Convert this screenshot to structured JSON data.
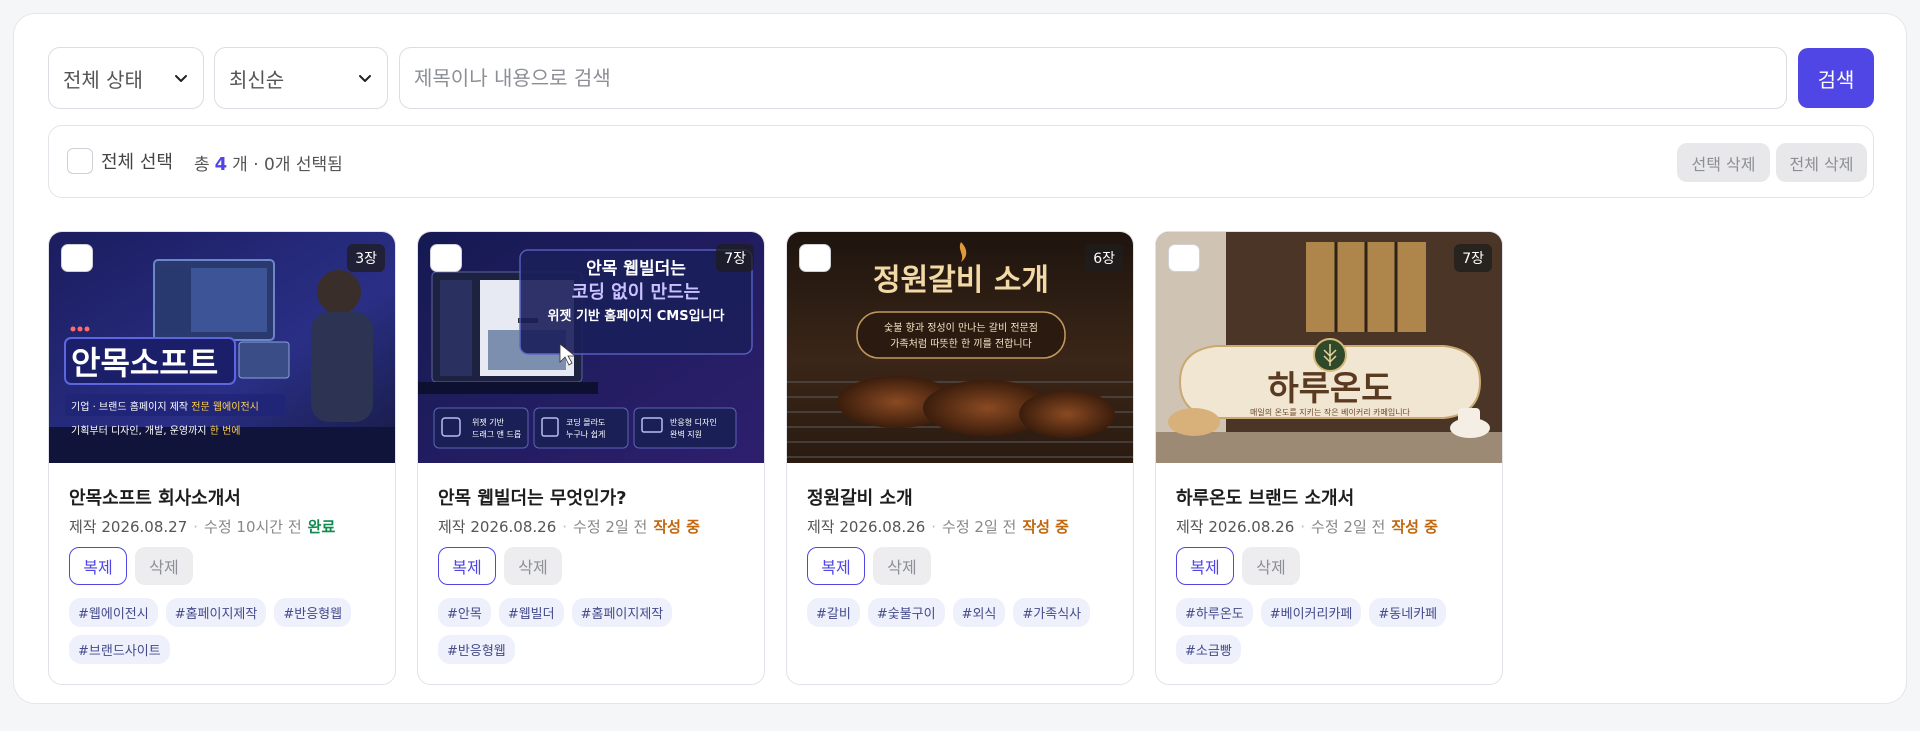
{
  "filters": {
    "status_label": "전체 상태",
    "sort_label": "최신순",
    "search_placeholder": "제목이나 내용으로 검색",
    "search_button": "검색"
  },
  "selection": {
    "select_all_label": "전체 선택",
    "total_prefix": "총",
    "total_count": "4",
    "total_suffix": "개 · 0개 선택됨",
    "delete_selected": "선택 삭제",
    "delete_all": "전체 삭제"
  },
  "cards": [
    {
      "title": "안목소프트 회사소개서",
      "pages": "3장",
      "created": "제작 2026.08.27",
      "modified": "수정 10시간 전",
      "status": "완료",
      "dup_label": "복제",
      "del_label": "삭제",
      "tags": [
        "#웹에이전시",
        "#홈페이지제작",
        "#반응형웹",
        "#브랜드사이트"
      ],
      "thumb": {
        "headline": "안목소프트",
        "line1a": "기업 · 브랜드 홈페이지 제작 ",
        "line1b": "전문 웹에이전시",
        "line2a": "기획부터 디자인, 개발, 운영까지 ",
        "line2b": "한 번에"
      }
    },
    {
      "title": "안목 웹빌더는 무엇인가?",
      "pages": "7장",
      "created": "제작 2026.08.26",
      "modified": "수정 2일 전",
      "status": "작성 중",
      "dup_label": "복제",
      "del_label": "삭제",
      "tags": [
        "#안목",
        "#웹빌더",
        "#홈페이지제작",
        "#반응형웹"
      ],
      "thumb": {
        "line1": "안목 웹빌더는",
        "line2": "코딩 없이 만드는",
        "line3": "위젯 기반 홈페이지 CMS입니다",
        "f1a": "위젯 기반",
        "f1b": "드래그 앤 드롭",
        "f2a": "코딩 몰라도",
        "f2b": "누구나 쉽게",
        "f3a": "반응형 디자인",
        "f3b": "완벽 지원"
      }
    },
    {
      "title": "정원갈비 소개",
      "pages": "6장",
      "created": "제작 2026.08.26",
      "modified": "수정 2일 전",
      "status": "작성 중",
      "dup_label": "복제",
      "del_label": "삭제",
      "tags": [
        "#갈비",
        "#숯불구이",
        "#외식",
        "#가족식사"
      ],
      "thumb": {
        "headline": "정원갈비 소개",
        "sub1": "숯불 향과 정성이 만나는 갈비 전문점",
        "sub2": "가족처럼 따뜻한 한 끼를 전합니다"
      }
    },
    {
      "title": "하루온도 브랜드 소개서",
      "pages": "7장",
      "created": "제작 2026.08.26",
      "modified": "수정 2일 전",
      "status": "작성 중",
      "dup_label": "복제",
      "del_label": "삭제",
      "tags": [
        "#하루온도",
        "#베이커리카페",
        "#동네카페",
        "#소금빵"
      ],
      "thumb": {
        "headline": "하루온도",
        "sub": "매일의 온도를 지키는 작은 베이커리 카페입니다"
      }
    }
  ],
  "colors": {
    "accent": "#4f46e5",
    "status_done": "#0f8a4f",
    "status_wip": "#c2670d"
  }
}
